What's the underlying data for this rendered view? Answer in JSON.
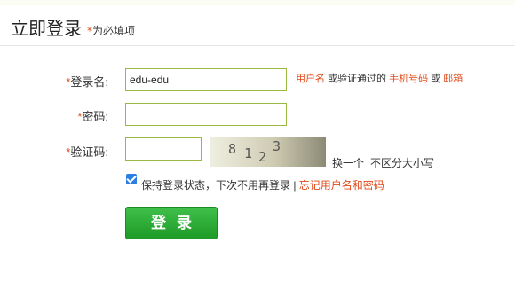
{
  "page": {
    "title": "立即登录",
    "required_mark": "*",
    "required_note": "为必填项"
  },
  "form": {
    "username": {
      "star": "*",
      "label": "登录名:",
      "value": "edu-edu"
    },
    "password": {
      "star": "*",
      "label": "密码:",
      "value": ""
    },
    "captcha": {
      "star": "*",
      "label": "验证码:",
      "value": "",
      "digits": [
        "8",
        "1",
        "2",
        "3"
      ]
    }
  },
  "hint": {
    "part1": "用户名",
    "part2": " 或验证通过的 ",
    "part3": "手机号码",
    "part4": " 或 ",
    "part5": "邮箱"
  },
  "captcha_actions": {
    "refresh": "换一个",
    "case_note": "不区分大小写"
  },
  "remember": {
    "checked": true,
    "text": "保持登录状态，下次不用再登录 |",
    "forgot": "忘记用户名和密码"
  },
  "buttons": {
    "login": "登录"
  },
  "colors": {
    "accent_red": "#e04a1a",
    "button_green": "#2fae38",
    "input_border": "#9ab840"
  }
}
